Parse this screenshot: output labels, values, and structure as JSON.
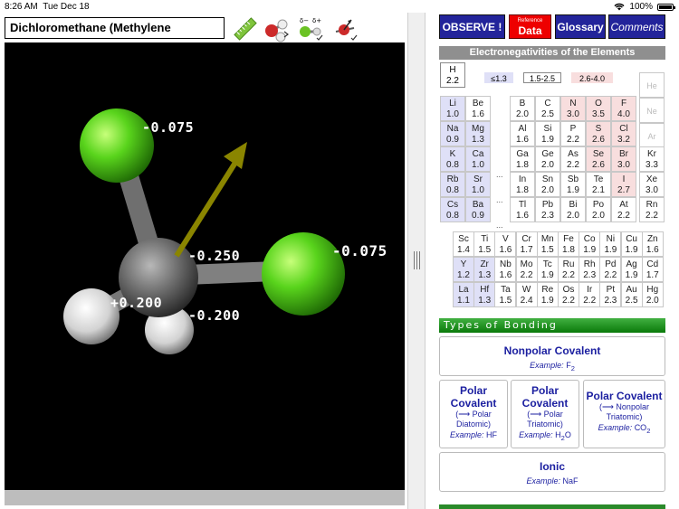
{
  "status": {
    "time": "8:26 AM",
    "date": "Tue Dec 18",
    "battery": "100%"
  },
  "molecule": {
    "title": "Dichloromethane (Methylene Chloride)",
    "charges": {
      "cl_top": "-0.075",
      "cl_right": "-0.075",
      "carbon": "-0.250",
      "h_left": "+0.200",
      "h_front": "-0.200"
    }
  },
  "tools": {
    "ruler": "ruler-icon",
    "model": "ball-stick-icon",
    "polarity": "partial-charge-icon",
    "dipole": "dipole-arrow-icon",
    "delta_minus": "δ−",
    "delta_plus": "δ+"
  },
  "buttons": {
    "observe": "OBSERVE !",
    "reference_small": "Reference",
    "reference_big": "Data",
    "glossary": "Glossary",
    "comments": "Comments"
  },
  "table": {
    "title": "Electronegativities of the Elements",
    "legend": [
      "≤1.3",
      "1.5-2.5",
      "2.6-4.0"
    ],
    "hydrogen": {
      "sym": "H",
      "val": "2.2"
    },
    "noble": [
      "He",
      "Ne",
      "Ar"
    ],
    "left_block": [
      [
        {
          "s": "Li",
          "v": "1.0",
          "c": "blue"
        },
        {
          "s": "Be",
          "v": "1.6",
          "c": "none"
        }
      ],
      [
        {
          "s": "Na",
          "v": "0.9",
          "c": "blue"
        },
        {
          "s": "Mg",
          "v": "1.3",
          "c": "blue"
        }
      ],
      [
        {
          "s": "K",
          "v": "0.8",
          "c": "blue"
        },
        {
          "s": "Ca",
          "v": "1.0",
          "c": "blue"
        }
      ],
      [
        {
          "s": "Rb",
          "v": "0.8",
          "c": "blue"
        },
        {
          "s": "Sr",
          "v": "1.0",
          "c": "blue"
        }
      ],
      [
        {
          "s": "Cs",
          "v": "0.8",
          "c": "blue"
        },
        {
          "s": "Ba",
          "v": "0.9",
          "c": "blue"
        }
      ]
    ],
    "p_block": [
      [
        {
          "s": "B",
          "v": "2.0",
          "c": "none"
        },
        {
          "s": "C",
          "v": "2.5",
          "c": "none"
        },
        {
          "s": "N",
          "v": "3.0",
          "c": "pink"
        },
        {
          "s": "O",
          "v": "3.5",
          "c": "pink"
        },
        {
          "s": "F",
          "v": "4.0",
          "c": "pink"
        }
      ],
      [
        {
          "s": "Al",
          "v": "1.6",
          "c": "none"
        },
        {
          "s": "Si",
          "v": "1.9",
          "c": "none"
        },
        {
          "s": "P",
          "v": "2.2",
          "c": "none"
        },
        {
          "s": "S",
          "v": "2.6",
          "c": "pink"
        },
        {
          "s": "Cl",
          "v": "3.2",
          "c": "pink"
        }
      ],
      [
        {
          "s": "Ga",
          "v": "1.8",
          "c": "none"
        },
        {
          "s": "Ge",
          "v": "2.0",
          "c": "none"
        },
        {
          "s": "As",
          "v": "2.2",
          "c": "none"
        },
        {
          "s": "Se",
          "v": "2.6",
          "c": "pink"
        },
        {
          "s": "Br",
          "v": "3.0",
          "c": "pink"
        }
      ],
      [
        {
          "s": "In",
          "v": "1.8",
          "c": "none"
        },
        {
          "s": "Sn",
          "v": "2.0",
          "c": "none"
        },
        {
          "s": "Sb",
          "v": "1.9",
          "c": "none"
        },
        {
          "s": "Te",
          "v": "2.1",
          "c": "none"
        },
        {
          "s": "I",
          "v": "2.7",
          "c": "pink"
        }
      ],
      [
        {
          "s": "Tl",
          "v": "1.6",
          "c": "none"
        },
        {
          "s": "Pb",
          "v": "2.3",
          "c": "none"
        },
        {
          "s": "Bi",
          "v": "2.0",
          "c": "none"
        },
        {
          "s": "Po",
          "v": "2.0",
          "c": "none"
        },
        {
          "s": "At",
          "v": "2.2",
          "c": "none"
        }
      ]
    ],
    "noble_rows": [
      {
        "s": "Kr",
        "v": "3.3"
      },
      {
        "s": "Xe",
        "v": "3.0"
      },
      {
        "s": "Rn",
        "v": "2.2"
      }
    ],
    "d_block": [
      [
        {
          "s": "Sc",
          "v": "1.4",
          "c": "none"
        },
        {
          "s": "Ti",
          "v": "1.5",
          "c": "none"
        },
        {
          "s": "V",
          "v": "1.6",
          "c": "none"
        },
        {
          "s": "Cr",
          "v": "1.7",
          "c": "none"
        },
        {
          "s": "Mn",
          "v": "1.5",
          "c": "none"
        },
        {
          "s": "Fe",
          "v": "1.8",
          "c": "none"
        },
        {
          "s": "Co",
          "v": "1.9",
          "c": "none"
        },
        {
          "s": "Ni",
          "v": "1.9",
          "c": "none"
        },
        {
          "s": "Cu",
          "v": "1.9",
          "c": "none"
        },
        {
          "s": "Zn",
          "v": "1.6",
          "c": "none"
        }
      ],
      [
        {
          "s": "Y",
          "v": "1.2",
          "c": "blue"
        },
        {
          "s": "Zr",
          "v": "1.3",
          "c": "blue"
        },
        {
          "s": "Nb",
          "v": "1.6",
          "c": "none"
        },
        {
          "s": "Mo",
          "v": "2.2",
          "c": "none"
        },
        {
          "s": "Tc",
          "v": "1.9",
          "c": "none"
        },
        {
          "s": "Ru",
          "v": "2.2",
          "c": "none"
        },
        {
          "s": "Rh",
          "v": "2.3",
          "c": "none"
        },
        {
          "s": "Pd",
          "v": "2.2",
          "c": "none"
        },
        {
          "s": "Ag",
          "v": "1.9",
          "c": "none"
        },
        {
          "s": "Cd",
          "v": "1.7",
          "c": "none"
        }
      ],
      [
        {
          "s": "La",
          "v": "1.1",
          "c": "blue"
        },
        {
          "s": "Hf",
          "v": "1.3",
          "c": "blue"
        },
        {
          "s": "Ta",
          "v": "1.5",
          "c": "none"
        },
        {
          "s": "W",
          "v": "2.4",
          "c": "none"
        },
        {
          "s": "Re",
          "v": "1.9",
          "c": "none"
        },
        {
          "s": "Os",
          "v": "2.2",
          "c": "none"
        },
        {
          "s": "Ir",
          "v": "2.2",
          "c": "none"
        },
        {
          "s": "Pt",
          "v": "2.3",
          "c": "none"
        },
        {
          "s": "Au",
          "v": "2.5",
          "c": "none"
        },
        {
          "s": "Hg",
          "v": "2.0",
          "c": "none"
        }
      ]
    ],
    "ellipsis": "..."
  },
  "bonding": {
    "title": "Types of Bonding",
    "example_prefix": "Example:",
    "nonpolar": {
      "title": "Nonpolar Covalent",
      "example": "F",
      "sub": "2"
    },
    "polar_diatomic": {
      "title1": "Polar",
      "title2": "Covalent",
      "note1": "(⟶ Polar",
      "note2": "Diatomic)",
      "example": "HF"
    },
    "polar_triatomic": {
      "title1": "Polar",
      "title2": "Covalent",
      "note1": "(⟶ Polar",
      "note2": "Triatomic)",
      "example": "H",
      "sub": "2",
      "example_tail": "O"
    },
    "polar_nonpolar": {
      "title": "Polar Covalent",
      "note1": "(⟶ Nonpolar",
      "note2": "Triatomic)",
      "example": "CO",
      "sub": "2"
    },
    "ionic": {
      "title": "Ionic",
      "example": "NaF"
    }
  }
}
